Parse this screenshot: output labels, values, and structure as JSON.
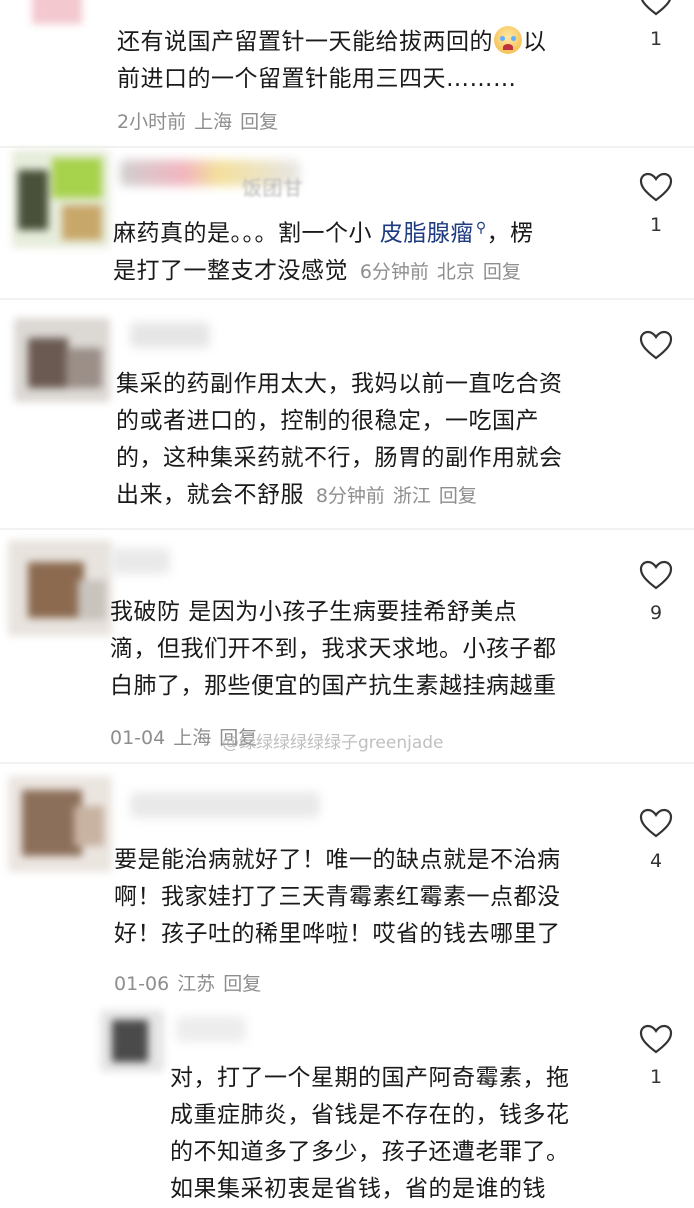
{
  "comments": [
    {
      "text_lines": [
        "还有说国产留置针一天能给拔两回的",
        "以",
        "前进口的一个留置针能用三四天………"
      ],
      "emoji": "crying-face-emoji",
      "time": "2小时前",
      "location": "上海",
      "reply": "回复",
      "likes": "1"
    },
    {
      "name_fragment": "饭团甘",
      "line1_pre": "麻药真的是。。。割一个小 ",
      "line1_link": "皮脂腺瘤",
      "line1_post": "，楞",
      "line2": "是打了一整支才没感觉",
      "time": "6分钟前",
      "location": "北京",
      "reply": "回复",
      "likes": "1"
    },
    {
      "lines": [
        "集采的药副作用太大，我妈以前一直吃合资",
        "的或者进口的，控制的很稳定，一吃国产",
        "的，这种集采药就不行，肠胃的副作用就会",
        "出来，就会不舒服"
      ],
      "time": "8分钟前",
      "location": "浙江",
      "reply": "回复",
      "likes": ""
    },
    {
      "lines": [
        "我破防 是因为小孩子生病要挂希舒美点",
        "滴，但我们开不到，我求天求地。小孩子都",
        "白肺了，那些便宜的国产抗生素越挂病越重"
      ],
      "time": "01-04",
      "location": "上海",
      "reply": "回复",
      "likes": "9"
    },
    {
      "lines": [
        "要是能治病就好了！唯一的缺点就是不治病",
        "啊！我家娃打了三天青霉素红霉素一点都没",
        "好！孩子吐的稀里哗啦！哎省的钱去哪里了"
      ],
      "time": "01-06",
      "location": "江苏",
      "reply": "回复",
      "likes": "4"
    },
    {
      "lines": [
        "对，打了一个星期的国产阿奇霉素，拖",
        "成重症肺炎，省钱是不存在的，钱多花",
        "的不知道多了多少，孩子还遭老罪了。",
        "如果集采初衷是省钱，省的是谁的钱"
      ],
      "likes": "1"
    }
  ],
  "watermark": "@绿绿绿绿绿绿子greenjade",
  "colors": {
    "link": "#1f3b80",
    "meta": "#8e8e8e",
    "text": "#1a1a1a"
  }
}
